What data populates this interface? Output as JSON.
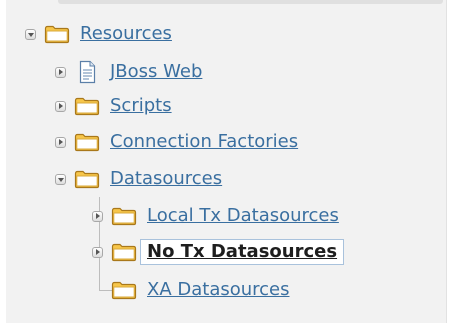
{
  "tree": {
    "resources": {
      "label": "Resources",
      "state": "expanded",
      "icon": "folder-icon"
    },
    "children": [
      {
        "label": "JBoss Web",
        "state": "collapsed",
        "icon": "document-icon"
      },
      {
        "label": "Scripts",
        "state": "collapsed",
        "icon": "folder-icon"
      },
      {
        "label": "Connection Factories",
        "state": "collapsed",
        "icon": "folder-icon"
      },
      {
        "label": "Datasources",
        "state": "expanded",
        "icon": "folder-icon"
      }
    ],
    "datasources": [
      {
        "label": "Local Tx Datasources",
        "state": "collapsed",
        "icon": "folder-icon"
      },
      {
        "label": "No Tx Datasources",
        "state": "collapsed",
        "icon": "folder-icon",
        "selected": true
      },
      {
        "label": "XA Datasources",
        "state": "leaf",
        "icon": "folder-icon"
      }
    ]
  },
  "colors": {
    "link": "#3a6fa0",
    "selected_text": "#1e1e1e",
    "folder_fill": "#f7c64a",
    "folder_stroke": "#a9781b",
    "panel_bg": "#f2f2f2"
  }
}
